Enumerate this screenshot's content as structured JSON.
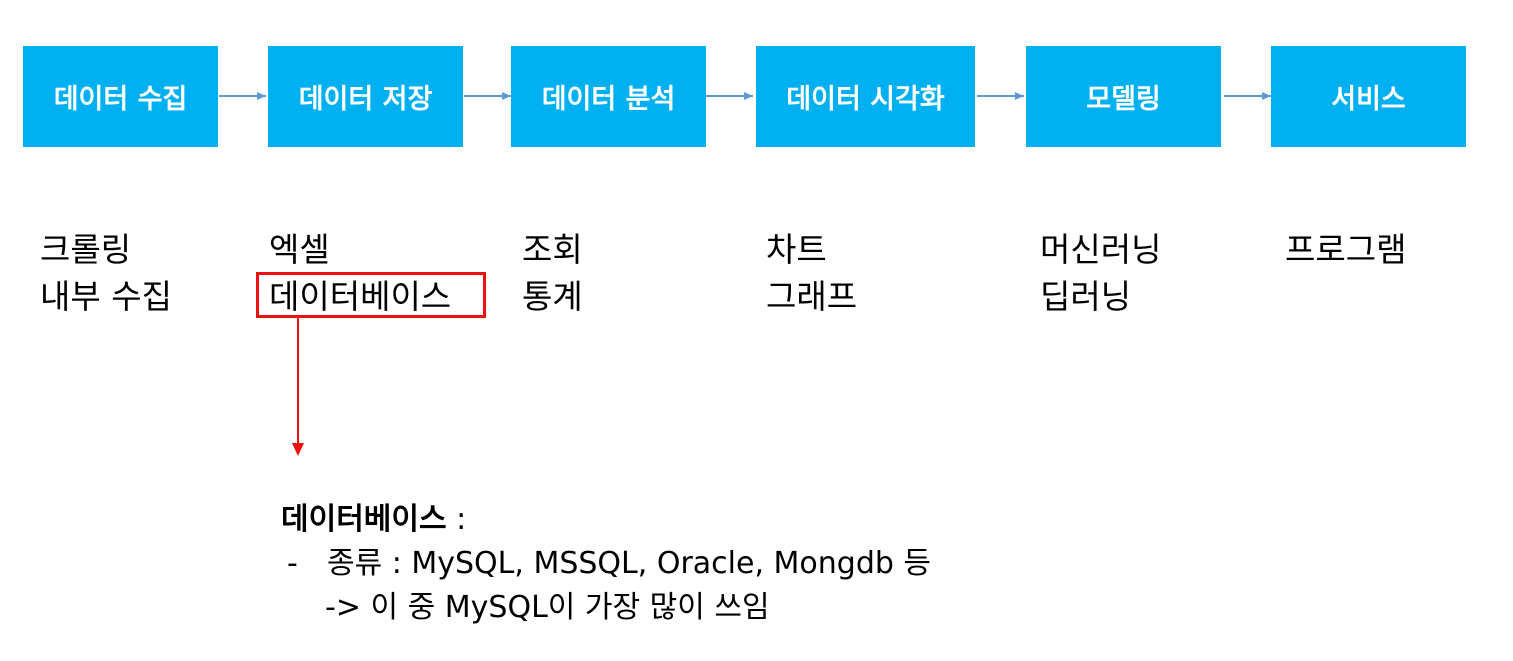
{
  "pipeline": [
    {
      "label": "데이터 수집",
      "items": [
        "크롤링",
        "내부 수집"
      ]
    },
    {
      "label": "데이터 저장",
      "items": [
        "엑셀",
        "데이터베이스"
      ]
    },
    {
      "label": "데이터 분석",
      "items": [
        "조회",
        "통계"
      ]
    },
    {
      "label": "데이터 시각화",
      "items": [
        "차트",
        "그래프"
      ]
    },
    {
      "label": "모델링",
      "items": [
        "머신러닝",
        "딥러닝"
      ]
    },
    {
      "label": "서비스",
      "items": [
        "프로그램"
      ]
    }
  ],
  "note": {
    "title": "데이터베이스",
    "colon": " :",
    "dash": "-",
    "line1": "종류 : MySQL, MSSQL, Oracle, Mongdb 등",
    "line2": "-> 이 중 MySQL이 가장 많이 쓰임"
  },
  "colors": {
    "box_fill": "#00b0f0",
    "arrow": "#5b9bd5",
    "highlight": "#ee1111"
  }
}
